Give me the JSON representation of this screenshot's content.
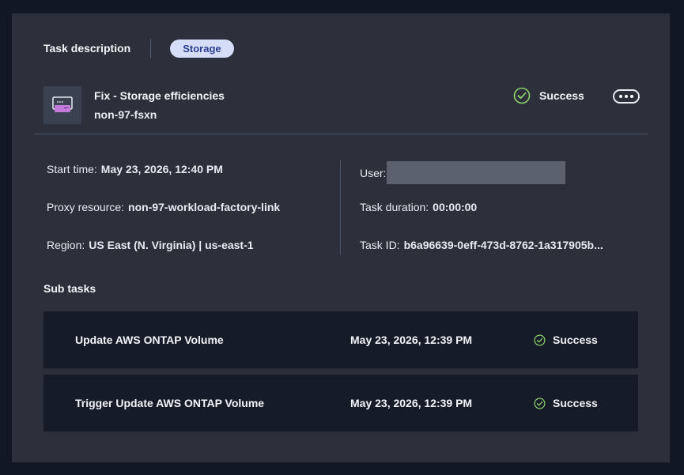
{
  "header": {
    "task_description_label": "Task description",
    "category_badge": "Storage"
  },
  "task": {
    "icon": "task-terminal-icon",
    "title": "Fix - Storage efficiencies",
    "subtitle": "non-97-fsxn",
    "status": "Success",
    "status_icon": "check-circle-icon",
    "more_icon": "more-horizontal-icon"
  },
  "details": {
    "start_time": {
      "label": "Start time:",
      "value": "May 23, 2026, 12:40 PM"
    },
    "proxy_resource": {
      "label": "Proxy resource:",
      "value": "non-97-workload-factory-link"
    },
    "region": {
      "label": "Region:",
      "value": "US East (N. Virginia) | us-east-1"
    },
    "user": {
      "label": "User:",
      "value": ""
    },
    "task_duration": {
      "label": "Task duration:",
      "value": "00:00:00"
    },
    "task_id": {
      "label": "Task ID:",
      "value": "b6a96639-0eff-473d-8762-1a317905b..."
    }
  },
  "subtasks": {
    "heading": "Sub tasks",
    "items": [
      {
        "name": "Update AWS ONTAP Volume",
        "time": "May 23, 2026, 12:39 PM",
        "status": "Success"
      },
      {
        "name": "Trigger Update AWS ONTAP Volume",
        "time": "May 23, 2026, 12:39 PM",
        "status": "Success"
      }
    ]
  },
  "colors": {
    "page_background": "#111824",
    "panel_background": "#2b303b",
    "row_background": "#151c28",
    "success_green": "#8fd16a",
    "badge_background": "#d5ddf7",
    "badge_text": "#2c3f8f",
    "icon_accent": "#c37bd9"
  }
}
